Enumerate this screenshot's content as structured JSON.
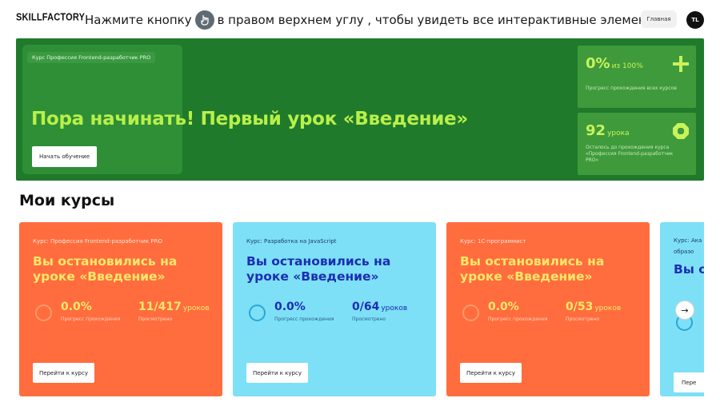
{
  "header": {
    "logo": "SKILLFACTORY",
    "instruction_before": "Нажмите кнопку",
    "instruction_after": "в правом верхнем углу , чтобы увидеть все интерактивные элементы.",
    "hint_icon": "hand-pointer-icon",
    "nav_home": "Главная",
    "avatar_initials": "TL"
  },
  "hero": {
    "tag": "Курс Профессия Frontend-разработчик PRO",
    "title": "Пора начинать! Первый урок «Введение»",
    "button": "Начать обучение",
    "stats": [
      {
        "value": "0%",
        "unit": "из 100%",
        "label": "Прогресс прохождения всех курсов",
        "icon": "plus-icon"
      },
      {
        "value": "92",
        "unit": "урока",
        "label": "Осталось до прохождения курса «Профессия Frontend-разработчик PRO»",
        "icon": "octagon-icon"
      }
    ]
  },
  "courses_section": {
    "title": "Мои курсы",
    "cards": [
      {
        "tag": "Курс: Профессия Frontend-разработчик PRO",
        "title": "Вы остановились на уроке «Введение»",
        "progress": "0.0%",
        "progress_label": "Прогресс прохождения",
        "lessons": "11/417",
        "lessons_unit": "уроков",
        "lessons_label": "Просмотрено",
        "button": "Перейти к курсу",
        "theme": "orange"
      },
      {
        "tag": "Курс: Разработка на JavaScript",
        "title": "Вы остановились на уроке «Введение»",
        "progress": "0.0%",
        "progress_label": "Прогресс прохождения",
        "lessons": "0/64",
        "lessons_unit": "уроков",
        "lessons_label": "Просмотрено",
        "button": "Перейти к курсу",
        "theme": "blue"
      },
      {
        "tag": "Курс: 1С-программист",
        "title": "Вы остановились на уроке «Введение»",
        "progress": "0.0%",
        "progress_label": "Прогресс прохождения",
        "lessons": "0/53",
        "lessons_unit": "уроков",
        "lessons_label": "Просмотрено",
        "button": "Перейти к курсу",
        "theme": "orange"
      },
      {
        "tag": "Курс: Ака образо",
        "title": "Вы о «Вве",
        "button": "Пере",
        "theme": "blue"
      }
    ],
    "scroll_arrow": "→"
  },
  "colors": {
    "hero_bg": "#1f7a2b",
    "hero_accent": "#b8f04a",
    "card_orange": "#ff6d3f",
    "card_blue": "#7de0f6",
    "title_yellow": "#ffe86a",
    "title_navy": "#1c2db3"
  }
}
